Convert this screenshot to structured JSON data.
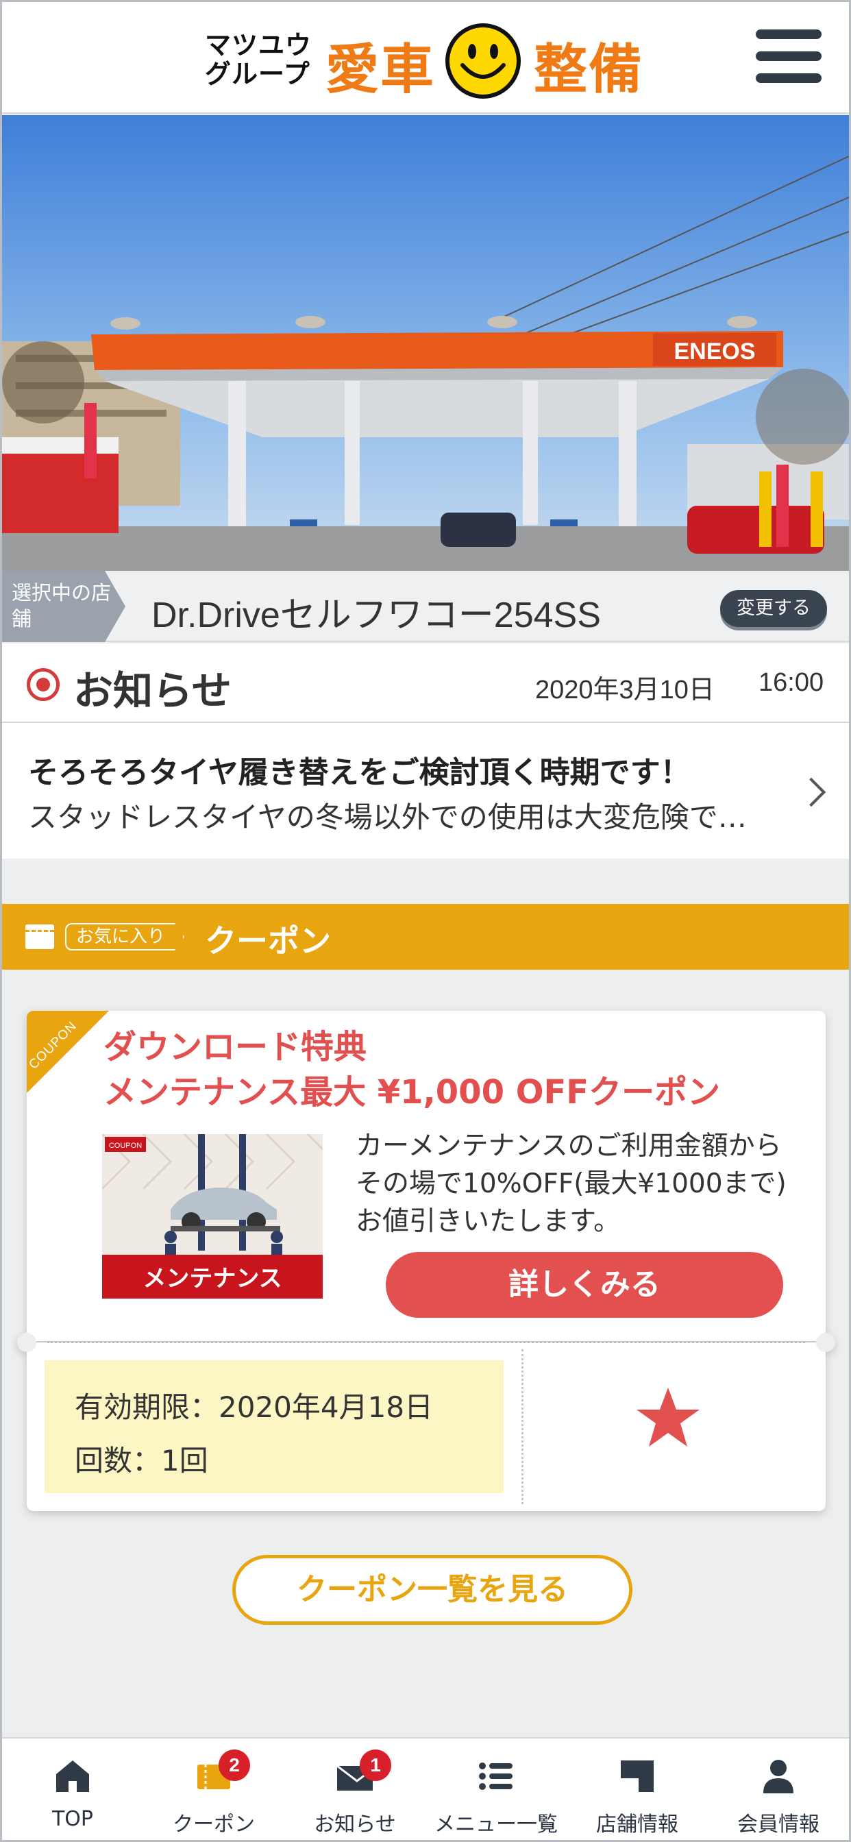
{
  "header": {
    "logo_group": "マツユウグループ",
    "logo_word1": "愛車",
    "logo_word2": "整備",
    "menu_icon": "hamburger-icon"
  },
  "hero": {
    "sign_text": "ENEOS"
  },
  "store": {
    "tag_label": "選択中の店舗",
    "name": "Dr.Driveセルフワコー254SS",
    "change_label": "変更する"
  },
  "news": {
    "title": "お知らせ",
    "date": "2020年3月10日",
    "time": "16:00",
    "item_title": "そろそろタイヤ履き替えをご検討頂く時期です！",
    "item_body": "スタッドレスタイヤの冬場以外での使用は大変危険で…"
  },
  "coupon_section": {
    "fav_tag": "お気に入り",
    "title": "クーポン"
  },
  "coupon": {
    "ribbon": "COUPON",
    "title_line1": "ダウンロード特典",
    "title_line2": "メンテナンス最大 ¥1,000 OFFクーポン",
    "image_caption": "メンテナンス",
    "image_ribbon": "COUPON",
    "description": "カーメンテナンスのご利用金額からその場で10%OFF(最大¥1000まで)お値引きいたします。",
    "detail_button": "詳しくみる",
    "validity": "有効期限：2020年4月18日",
    "count": "回数：1回",
    "star_color": "#e24f4f"
  },
  "list_button": "クーポン一覧を見る",
  "tabbar": {
    "items": [
      {
        "label": "TOP",
        "icon": "home-icon"
      },
      {
        "label": "クーポン",
        "icon": "coupon-icon",
        "badge": "2"
      },
      {
        "label": "お知らせ",
        "icon": "mail-icon",
        "badge": "1"
      },
      {
        "label": "メニュー一覧",
        "icon": "list-icon"
      },
      {
        "label": "店舗情報",
        "icon": "store-icon"
      },
      {
        "label": "会員情報",
        "icon": "person-icon"
      }
    ]
  },
  "colors": {
    "accent_orange": "#f07a14",
    "coupon_yellow": "#e8a510",
    "coupon_red": "#e25050",
    "dark": "#2f3a46"
  }
}
